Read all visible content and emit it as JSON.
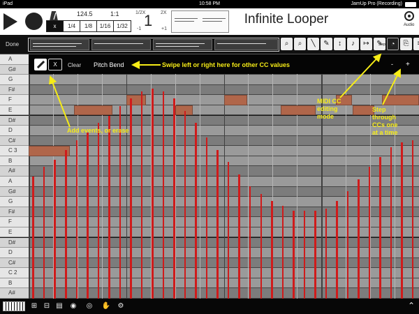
{
  "status": {
    "device": "iPad",
    "time": "10:58 PM",
    "app_status": "JamUp Pro (Recording)"
  },
  "transport": {
    "tempo": "124.5",
    "ratio": "1:1",
    "quantize": [
      "x",
      "1/4",
      "1/8",
      "1/16",
      "1/32"
    ],
    "quantize_selected": "x",
    "half_label": "1/2X",
    "minus_one": "-1",
    "loop_count": "1",
    "double_label": "2X",
    "plus_one": "+1"
  },
  "app_title": "Infinite Looper",
  "audio_label": "Audio",
  "toolbar": {
    "done_label": "Done",
    "tools": [
      "zoom-in",
      "zoom-out",
      "line",
      "pencil",
      "stretch",
      "velocity",
      "pointer",
      "pen-step",
      "midi-cc",
      "export",
      "menu"
    ],
    "step_label": "Step"
  },
  "cc_header": {
    "x_label": "X",
    "clear_label": "Clear",
    "cc_name": "Pitch Bend",
    "minus": "-",
    "plus": "+"
  },
  "piano_keys": [
    "A",
    "G#",
    "G",
    "F#",
    "F",
    "E",
    "D#",
    "D",
    "C#",
    "C 3",
    "B",
    "A#",
    "A",
    "G#",
    "G",
    "F#",
    "F",
    "E",
    "D#",
    "D",
    "C#",
    "C 2",
    "B",
    "A#"
  ],
  "notes": [
    {
      "key": "C 3",
      "start": 0.0,
      "length": 0.105
    },
    {
      "key": "E",
      "start": 0.117,
      "length": 0.098
    },
    {
      "key": "F",
      "start": 0.25,
      "length": 0.05
    },
    {
      "key": "E",
      "start": 0.375,
      "length": 0.045
    },
    {
      "key": "F",
      "start": 0.5,
      "length": 0.06
    },
    {
      "key": "E",
      "start": 0.645,
      "length": 0.09
    },
    {
      "key": "F",
      "start": 0.788,
      "length": 0.04
    },
    {
      "key": "E",
      "start": 0.83,
      "length": 0.055
    },
    {
      "key": "F",
      "start": 0.905,
      "length": 0.095
    }
  ],
  "cc_values": [
    0.5,
    0.54,
    0.57,
    0.61,
    0.65,
    0.68,
    0.72,
    0.75,
    0.79,
    0.82,
    0.85,
    0.86,
    0.85,
    0.82,
    0.77,
    0.72,
    0.66,
    0.61,
    0.56,
    0.51,
    0.46,
    0.43,
    0.4,
    0.38,
    0.36,
    0.36,
    0.36,
    0.37,
    0.4,
    0.44,
    0.49,
    0.54,
    0.58,
    0.62,
    0.64,
    0.65
  ],
  "annotations": {
    "swipe": "Swipe left or right here for other CC values",
    "add": "Add events, or erase",
    "midi": [
      "MIDI CC",
      "editing",
      "mode"
    ],
    "step": [
      "Step",
      "through",
      "CCs one",
      "at  a time"
    ]
  },
  "colors": {
    "note": "#b0664a",
    "cc_bar": "#d01b1b",
    "annotation": "#f6ec17"
  },
  "bottom_icons": [
    "piano-icon",
    "mixer-icon",
    "split-icon",
    "list-icon",
    "folder-icon",
    "record-icon",
    "wave-eye-icon",
    "wave-hand-icon",
    "gear-icon",
    "expand-icon"
  ]
}
